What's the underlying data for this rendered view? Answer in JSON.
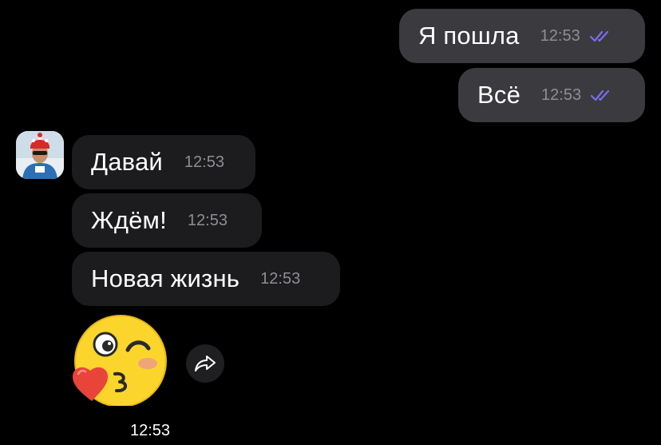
{
  "messages": {
    "out": [
      {
        "text": "Я пошла",
        "time": "12:53",
        "status_icon": "double-check-icon"
      },
      {
        "text": "Всё",
        "time": "12:53",
        "status_icon": "double-check-icon"
      }
    ],
    "in": [
      {
        "text": "Давай",
        "time": "12:53"
      },
      {
        "text": "Ждём!",
        "time": "12:53"
      },
      {
        "text": "Новая жизнь",
        "time": "12:53"
      }
    ]
  },
  "sticker": {
    "name": "kissing-wink-emoji",
    "time": "12:53"
  },
  "share": {
    "icon": "share-arrow-icon"
  },
  "colors": {
    "background": "#000000",
    "outgoing_bubble": "#3a3a3f",
    "incoming_bubble": "#1c1c1f",
    "read_check": "#7c6cf0",
    "time_text": "#8e8e93"
  }
}
